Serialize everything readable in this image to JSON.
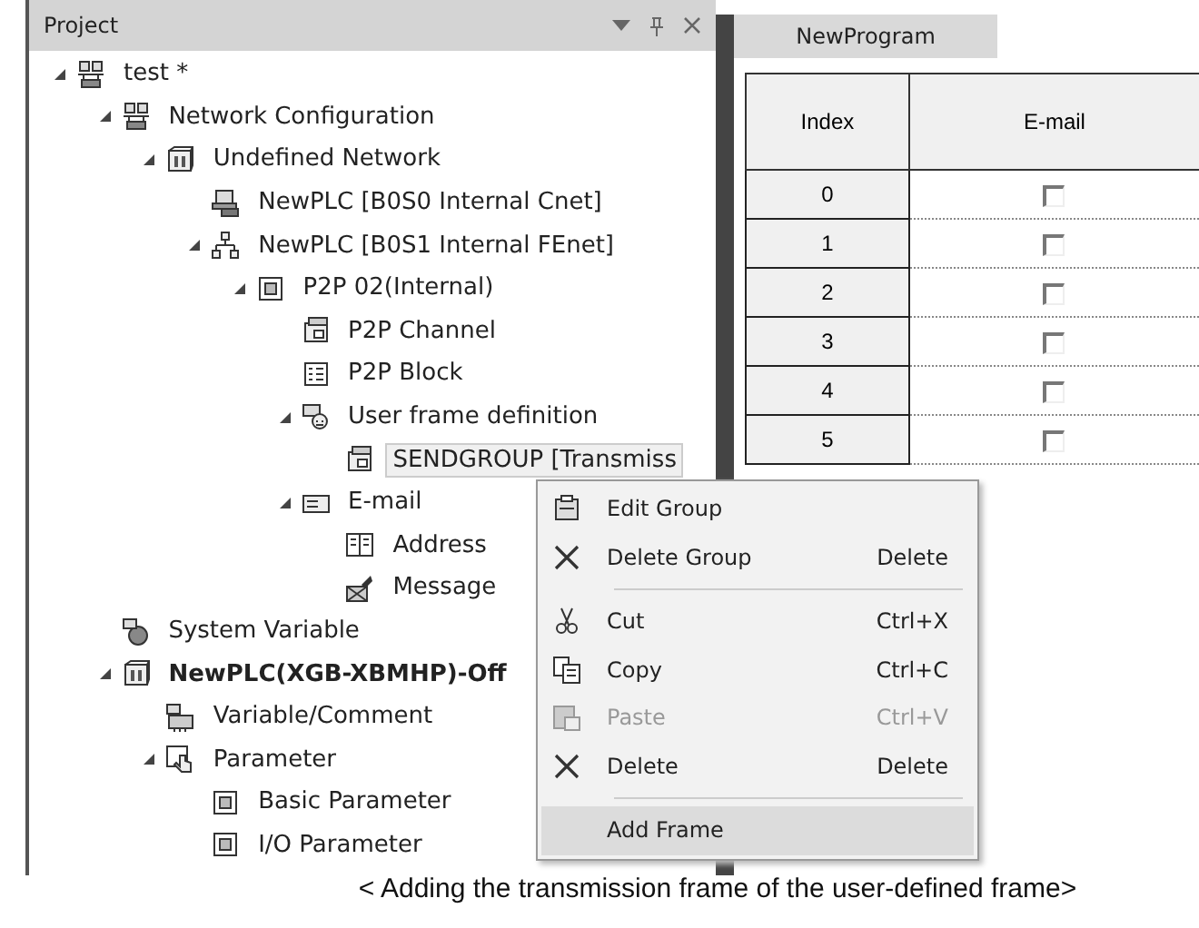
{
  "project_panel": {
    "title": "Project",
    "tree": [
      {
        "label": "test *",
        "kind": "project",
        "expanded": true,
        "selected": false,
        "bold": false,
        "children": [
          {
            "label": "Network Configuration",
            "kind": "project",
            "expanded": true,
            "selected": false,
            "bold": false,
            "children": [
              {
                "label": "Undefined Network",
                "kind": "box",
                "expanded": true,
                "selected": false,
                "bold": false,
                "children": [
                  {
                    "label": "NewPLC [B0S0 Internal Cnet]",
                    "kind": "serial",
                    "selected": false,
                    "bold": false
                  },
                  {
                    "label": "NewPLC [B0S1 Internal FEnet]",
                    "kind": "ethernet",
                    "expanded": true,
                    "selected": false,
                    "bold": false,
                    "children": [
                      {
                        "label": "P2P 02(Internal)",
                        "kind": "frame",
                        "expanded": true,
                        "selected": false,
                        "bold": false,
                        "children": [
                          {
                            "label": "P2P Channel",
                            "kind": "window",
                            "selected": false,
                            "bold": false
                          },
                          {
                            "label": "P2P Block",
                            "kind": "list",
                            "selected": false,
                            "bold": false
                          },
                          {
                            "label": "User frame definition",
                            "kind": "user",
                            "expanded": true,
                            "selected": false,
                            "bold": false,
                            "children": [
                              {
                                "label": "SENDGROUP [Transmiss",
                                "kind": "window",
                                "selected": true,
                                "bold": false
                              }
                            ]
                          },
                          {
                            "label": "E-mail",
                            "kind": "mail",
                            "expanded": true,
                            "selected": false,
                            "bold": false,
                            "children": [
                              {
                                "label": "Address",
                                "kind": "book",
                                "selected": false,
                                "bold": false
                              },
                              {
                                "label": "Message",
                                "kind": "message",
                                "selected": false,
                                "bold": false
                              }
                            ]
                          }
                        ]
                      }
                    ]
                  }
                ]
              }
            ]
          },
          {
            "label": "System Variable",
            "kind": "globe",
            "selected": false,
            "bold": false
          },
          {
            "label": "NewPLC(XGB-XBMHP)-Off",
            "kind": "box",
            "expanded": true,
            "selected": false,
            "bold": true,
            "children": [
              {
                "label": "Variable/Comment",
                "kind": "variable",
                "selected": false,
                "bold": false
              },
              {
                "label": "Parameter",
                "kind": "hand",
                "expanded": true,
                "selected": false,
                "bold": false,
                "children": [
                  {
                    "label": "Basic Parameter",
                    "kind": "frame",
                    "selected": false,
                    "bold": false
                  },
                  {
                    "label": "I/O Parameter",
                    "kind": "frame",
                    "selected": false,
                    "bold": false
                  }
                ]
              }
            ]
          }
        ]
      }
    ]
  },
  "editor": {
    "tab": "NewProgram",
    "columns": [
      "Index",
      "E-mail"
    ],
    "rows": [
      {
        "index": "0",
        "checked": false
      },
      {
        "index": "1",
        "checked": false
      },
      {
        "index": "2",
        "checked": false
      },
      {
        "index": "3",
        "checked": false
      },
      {
        "index": "4",
        "checked": false
      },
      {
        "index": "5",
        "checked": false
      }
    ]
  },
  "context_menu": [
    {
      "kind": "edit",
      "label": "Edit Group",
      "disabled": false,
      "selected": false
    },
    {
      "kind": "delete",
      "label": "Delete Group",
      "shortcut": "Delete",
      "disabled": false,
      "selected": false
    },
    {
      "kind": "separator"
    },
    {
      "kind": "cut",
      "label": "Cut",
      "shortcut": "Ctrl+X",
      "disabled": false,
      "selected": false
    },
    {
      "kind": "copy",
      "label": "Copy",
      "shortcut": "Ctrl+C",
      "disabled": false,
      "selected": false
    },
    {
      "kind": "paste",
      "label": "Paste",
      "shortcut": "Ctrl+V",
      "disabled": true,
      "selected": false
    },
    {
      "kind": "delete",
      "label": "Delete",
      "shortcut": "Delete",
      "disabled": false,
      "selected": false
    },
    {
      "kind": "separator"
    },
    {
      "kind": "plain",
      "label": "Add Frame",
      "disabled": false,
      "selected": true
    }
  ],
  "caption": "< Adding the transmission frame of the user-defined frame>"
}
